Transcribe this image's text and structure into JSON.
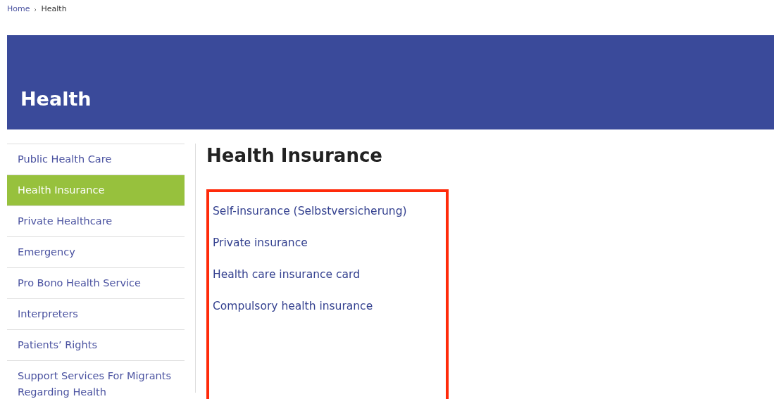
{
  "breadcrumb": [
    {
      "label": "Home",
      "current": false
    },
    {
      "label": "Health",
      "current": true
    }
  ],
  "banner": {
    "title": "Health"
  },
  "sidebar": {
    "items": [
      {
        "label": "Public Health Care",
        "selected": false
      },
      {
        "label": "Health Insurance",
        "selected": true
      },
      {
        "label": "Private Healthcare",
        "selected": false
      },
      {
        "label": "Emergency",
        "selected": false
      },
      {
        "label": "Pro Bono Health Service",
        "selected": false
      },
      {
        "label": "Interpreters",
        "selected": false
      },
      {
        "label": "Patients’ Rights",
        "selected": false
      },
      {
        "label": "Support Services For Migrants Regarding Health",
        "selected": false
      }
    ]
  },
  "content": {
    "heading": "Health Insurance",
    "links": [
      "Self-insurance (Selbstversicherung)",
      "Private insurance",
      "Health care insurance card",
      "Compulsory health insurance"
    ]
  }
}
